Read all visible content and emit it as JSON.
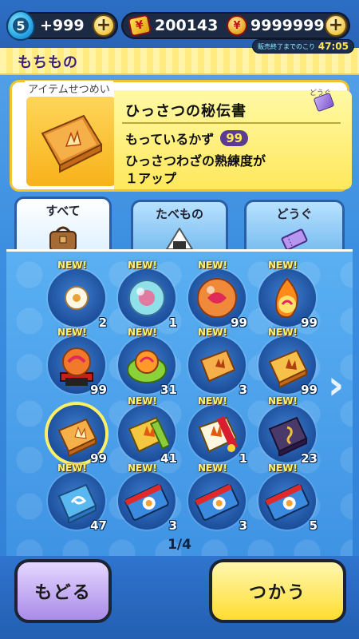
{
  "top": {
    "stamina_level": "5",
    "stamina_value": "+999",
    "money": "200143",
    "coins": "9999999",
    "sale_label": "販売終了までのこり",
    "sale_timer": "47:05"
  },
  "header": {
    "title": "もちもの"
  },
  "description": {
    "caption": "アイテムせつめい",
    "category_tag": "どうぐ",
    "item_name": "ひっさつの秘伝書",
    "count_label": "もっているかず",
    "count_value": "99",
    "effect": "ひっさつわざの熟練度が\n１アップ"
  },
  "tabs": [
    {
      "label": "すべて",
      "active": true
    },
    {
      "label": "たべもの",
      "active": false
    },
    {
      "label": "どうぐ",
      "active": false
    }
  ],
  "items": [
    {
      "icon": "white-orb-icon",
      "count": "2",
      "is_new": true,
      "new_label": "NEW!"
    },
    {
      "icon": "blue-orb-icon",
      "count": "1",
      "is_new": true,
      "new_label": "NEW!"
    },
    {
      "icon": "red-orb-icon",
      "count": "99",
      "is_new": true,
      "new_label": "NEW!"
    },
    {
      "icon": "flame-orb-icon",
      "count": "99",
      "is_new": true,
      "new_label": "NEW!"
    },
    {
      "icon": "orb-on-stand-icon",
      "count": "99",
      "is_new": true,
      "new_label": "NEW!"
    },
    {
      "icon": "green-orb-wreath-icon",
      "count": "31",
      "is_new": true,
      "new_label": "NEW!"
    },
    {
      "icon": "small-scroll-book-icon",
      "count": "3",
      "is_new": true,
      "new_label": "NEW!"
    },
    {
      "icon": "scroll-book-icon",
      "count": "99",
      "is_new": true,
      "new_label": "NEW!"
    },
    {
      "icon": "secret-book-icon",
      "count": "99",
      "is_new": false,
      "selected": true
    },
    {
      "icon": "golden-book-icon",
      "count": "41",
      "is_new": true,
      "new_label": "NEW!"
    },
    {
      "icon": "red-ribbon-book-icon",
      "count": "1",
      "is_new": true,
      "new_label": "NEW!"
    },
    {
      "icon": "dark-book-icon",
      "count": "23",
      "is_new": true,
      "new_label": "NEW!"
    },
    {
      "icon": "blue-book-icon",
      "count": "47",
      "is_new": true,
      "new_label": "NEW!"
    },
    {
      "icon": "ticket-icon",
      "count": "3",
      "is_new": true,
      "new_label": "NEW!"
    },
    {
      "icon": "ticket-icon",
      "count": "3",
      "is_new": true,
      "new_label": "NEW!"
    },
    {
      "icon": "ticket-icon",
      "count": "5",
      "is_new": true,
      "new_label": "NEW!"
    }
  ],
  "page_indicator": "1/4",
  "buttons": {
    "back": "もどる",
    "use": "つかう"
  },
  "colors": {
    "accent_yellow": "#ffdd30",
    "panel_blue": "#3f93e4",
    "back_purple": "#a98be8"
  }
}
